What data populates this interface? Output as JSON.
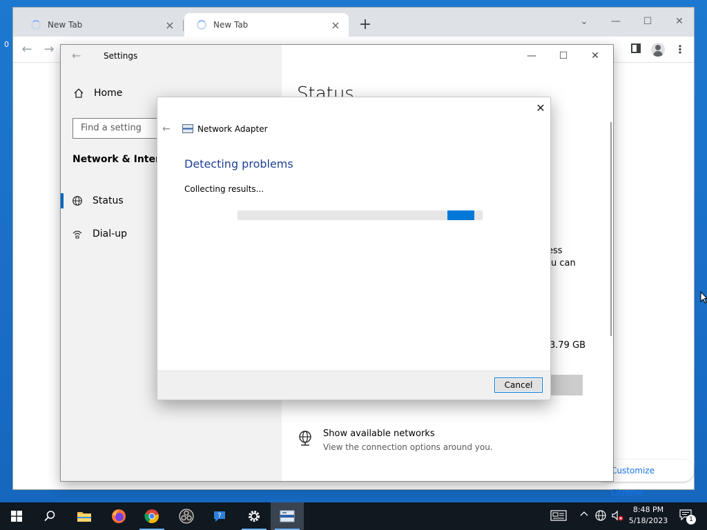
{
  "desktop": {
    "edge_fragment": "0"
  },
  "chrome": {
    "tabs": [
      {
        "title": "New Tab",
        "close": "×"
      },
      {
        "title": "New Tab",
        "close": "×"
      }
    ],
    "new_tab": "+",
    "window_controls": {
      "dropdown": "⌄",
      "minimize": "—",
      "maximize": "☐",
      "close": "✕"
    },
    "toolbar": {
      "back": "←",
      "forward": "→",
      "menu": "⋮"
    },
    "customize_button": "Customize Chrome"
  },
  "settings": {
    "back": "←",
    "title": "Settings",
    "window_controls": {
      "minimize": "—",
      "maximize": "☐",
      "close": "✕"
    },
    "home_label": "Home",
    "search_placeholder": "Find a setting",
    "section_heading": "Network & Internet",
    "nav": [
      {
        "label": "Status",
        "active": true
      },
      {
        "label": "Dial-up",
        "active": false
      }
    ],
    "main": {
      "heading": "Status",
      "fragment_1": "ess",
      "fragment_2": "u can",
      "fragment_3": "3.79 GB",
      "show_networks_title": "Show available networks",
      "show_networks_sub": "View the connection options around you."
    }
  },
  "troubleshooter": {
    "close": "✕",
    "back": "←",
    "app_name": "Network Adapter",
    "heading": "Detecting problems",
    "status_text": "Collecting results...",
    "progress": {
      "indeterminate": true,
      "marquee_start_fraction": 0.855,
      "marquee_width_fraction": 0.11
    },
    "cancel_label": "Cancel"
  },
  "taskbar": {
    "apps": [
      "start",
      "search",
      "file-explorer",
      "firefox",
      "chrome",
      "obs-studio",
      "get-help",
      "settings",
      "network-troubleshooter"
    ],
    "clock_time": "8:48 PM",
    "clock_date": "5/18/2023",
    "notification_count": "1"
  },
  "colors": {
    "accent": "#0078d7",
    "dialog_heading": "#1c3f94",
    "desktop": "#1a73c9",
    "taskbar": "#101820",
    "chrome_link": "#1a73e8"
  }
}
